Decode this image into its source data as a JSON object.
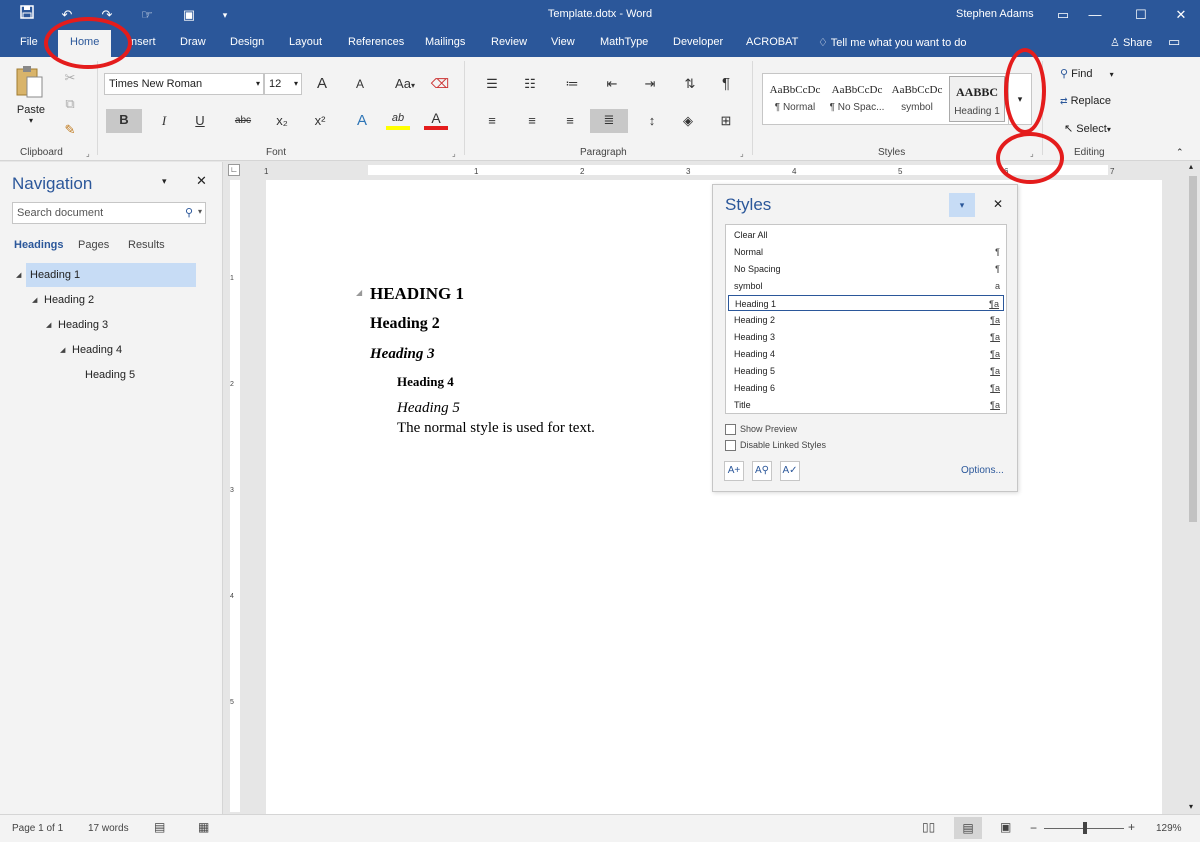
{
  "titlebar": {
    "title": "Template.dotx - Word",
    "user": "Stephen Adams",
    "icons": [
      "save-icon",
      "undo-icon",
      "redo-icon",
      "touch-mode-icon",
      "document-icon",
      "customize-icon",
      "ribbon-display-icon",
      "minimize-icon",
      "maximize-icon",
      "close-icon"
    ]
  },
  "tabs": [
    {
      "label": "File"
    },
    {
      "label": "Home"
    },
    {
      "label": "Insert"
    },
    {
      "label": "Draw"
    },
    {
      "label": "Design"
    },
    {
      "label": "Layout"
    },
    {
      "label": "References"
    },
    {
      "label": "Mailings"
    },
    {
      "label": "Review"
    },
    {
      "label": "View"
    },
    {
      "label": "MathType"
    },
    {
      "label": "Developer"
    },
    {
      "label": "ACROBAT"
    }
  ],
  "tellme": "Tell me what you want to do",
  "share": "Share",
  "ribbon": {
    "clipboard": {
      "paste": "Paste",
      "label": "Clipboard"
    },
    "font": {
      "name": "Times New Roman",
      "size": "12",
      "label": "Font",
      "bold": "B",
      "italic": "I",
      "underline": "U",
      "strike": "abc",
      "sub": "x₂",
      "sup": "x²",
      "grow": "A",
      "shrink": "A",
      "case": "Aa",
      "highlight": "ab",
      "fontcolor": "A",
      "effects": "A"
    },
    "paragraph": {
      "label": "Paragraph",
      "pilcrow": "¶"
    },
    "styles": {
      "label": "Styles",
      "items": [
        {
          "preview": "AaBbCcDc",
          "name": "¶ Normal"
        },
        {
          "preview": "AaBbCcDc",
          "name": "¶ No Spac..."
        },
        {
          "preview": "AaBbCcDc",
          "name": "symbol"
        },
        {
          "preview": "AABBC",
          "name": "Heading 1"
        }
      ]
    },
    "editing": {
      "label": "Editing",
      "find": "Find",
      "replace": "Replace",
      "select": "Select"
    }
  },
  "navigation": {
    "title": "Navigation",
    "search_placeholder": "Search document",
    "tabs": [
      "Headings",
      "Pages",
      "Results"
    ],
    "headings": [
      {
        "label": "Heading 1",
        "level": 1
      },
      {
        "label": "Heading 2",
        "level": 2
      },
      {
        "label": "Heading 3",
        "level": 3
      },
      {
        "label": "Heading 4",
        "level": 4
      },
      {
        "label": "Heading 5",
        "level": 5
      }
    ]
  },
  "document": {
    "h1": "HEADING 1",
    "h2": "Heading 2",
    "h3": "Heading 3",
    "h4": "Heading 4",
    "h5": "Heading 5",
    "body": "The normal style is used for text."
  },
  "ruler": {
    "h_ticks": [
      "1",
      "1",
      "2",
      "3",
      "4",
      "5",
      "6",
      "7"
    ],
    "v_ticks": [
      "1",
      "2",
      "3",
      "4",
      "5"
    ]
  },
  "styles_pane": {
    "title": "Styles",
    "items": [
      {
        "name": "Clear All",
        "mark": ""
      },
      {
        "name": "Normal",
        "mark": "¶"
      },
      {
        "name": "No Spacing",
        "mark": "¶"
      },
      {
        "name": "symbol",
        "mark": "a"
      },
      {
        "name": "Heading 1",
        "mark": "¶a"
      },
      {
        "name": "Heading 2",
        "mark": "¶a"
      },
      {
        "name": "Heading 3",
        "mark": "¶a"
      },
      {
        "name": "Heading 4",
        "mark": "¶a"
      },
      {
        "name": "Heading 5",
        "mark": "¶a"
      },
      {
        "name": "Heading 6",
        "mark": "¶a"
      },
      {
        "name": "Title",
        "mark": "¶a"
      }
    ],
    "show_preview": "Show Preview",
    "disable_linked": "Disable Linked Styles",
    "options": "Options..."
  },
  "status": {
    "page": "Page 1 of 1",
    "words": "17 words",
    "zoom": "129%"
  }
}
